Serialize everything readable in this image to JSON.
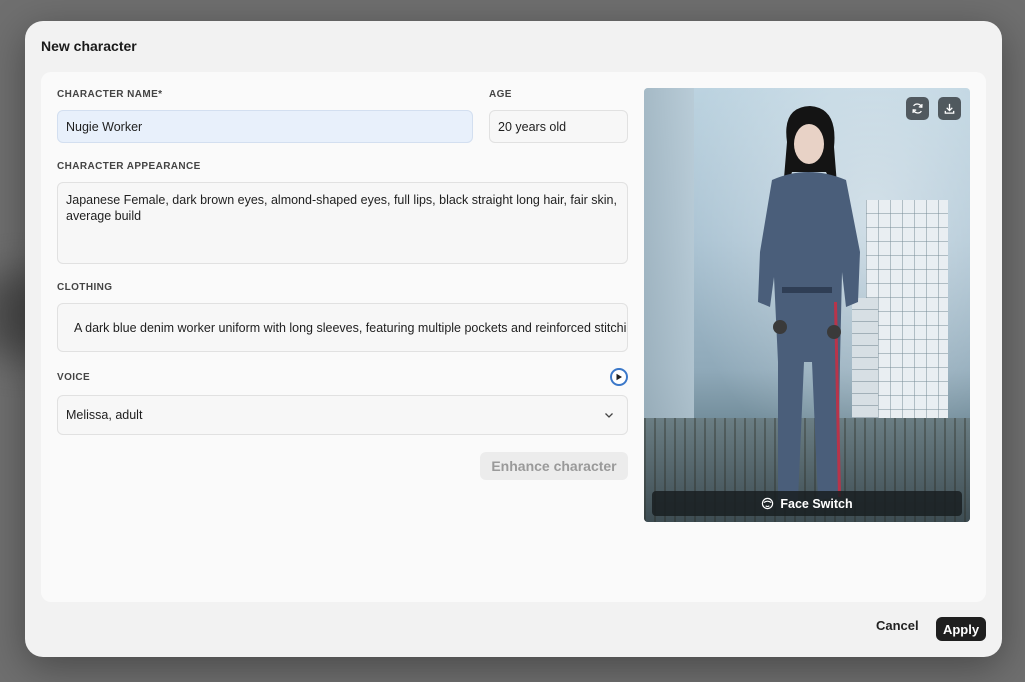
{
  "dialog": {
    "title": "New character"
  },
  "form": {
    "name_label": "CHARACTER NAME*",
    "name_value": "Nugie Worker",
    "age_label": "AGE",
    "age_value": "20 years old",
    "appearance_label": "CHARACTER APPEARANCE",
    "appearance_value": "Japanese Female, dark brown eyes, almond-shaped eyes, full lips, black straight long hair, fair skin, average build",
    "clothing_label": "CLOTHING",
    "clothing_value": "A dark blue denim worker uniform with long sleeves, featuring multiple pockets and reinforced stitching",
    "voice_label": "VOICE",
    "voice_value": "Melissa, adult",
    "enhance_label": "Enhance character"
  },
  "image_panel": {
    "face_switch_label": "Face Switch",
    "icons": [
      "refresh-icon",
      "download-icon",
      "face-icon"
    ]
  },
  "footer": {
    "cancel_label": "Cancel",
    "apply_label": "Apply"
  },
  "colors": {
    "accent": "#3b78c9",
    "primary_button": "#1f1f1f",
    "name_field_bg": "#e8f0fb"
  }
}
